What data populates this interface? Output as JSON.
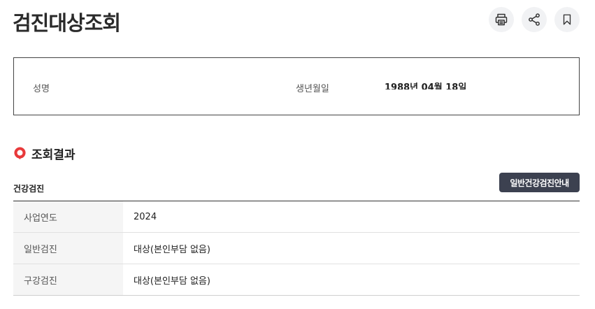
{
  "page": {
    "title": "검진대상조회"
  },
  "actions": [
    {
      "icon": "print-icon"
    },
    {
      "icon": "share-icon"
    },
    {
      "icon": "bookmark-icon"
    }
  ],
  "info": {
    "name_label": "성명",
    "name_value": "",
    "birth_label": "생년월일",
    "birth_value": "1988년 04월 18일"
  },
  "results": {
    "section_title": "조회결과",
    "subsection_title": "건강검진",
    "guide_button_label": "일반건강검진안내",
    "rows": [
      {
        "label": "사업연도",
        "value": "2024"
      },
      {
        "label": "일반검진",
        "value": "대상(본인부담 없음)"
      },
      {
        "label": "구강검진",
        "value": "대상(본인부담 없음)"
      }
    ]
  },
  "colors": {
    "accent": "#e8393a",
    "button_bg": "#3c4150",
    "icon_button_bg": "#f1f2f4"
  }
}
